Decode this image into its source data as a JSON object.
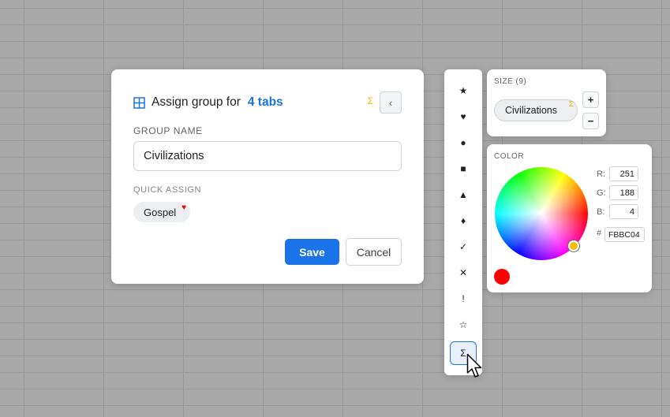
{
  "dialog": {
    "icon": "grid-icon",
    "title": "Assign group for",
    "count": "4 tabs",
    "back_icon": "‹",
    "indicator": "Σ",
    "group_name_label": "GROUP NAME",
    "group_name_value": "Civilizations",
    "quick_assign_label": "QUICK ASSIGN",
    "quick_chip": {
      "label": "Gospel",
      "badge": "♥"
    },
    "save_label": "Save",
    "cancel_label": "Cancel"
  },
  "palette": {
    "symbols": [
      "★",
      "♥",
      "●",
      "■",
      "▲",
      "♦",
      "✓",
      "✕",
      "!",
      "☆",
      "Σ"
    ],
    "selected_index": 10
  },
  "size_panel": {
    "label": "SIZE (9)",
    "chip_label": "Civilizations",
    "chip_badge": "Σ",
    "increase": "+",
    "decrease": "−"
  },
  "color_panel": {
    "label": "COLOR",
    "r_label": "R:",
    "r": "251",
    "g_label": "G:",
    "g": "188",
    "b_label": "B:",
    "b": "4",
    "hash_label": "#",
    "hex": "FBBC04",
    "selected_color": "#FBBC04",
    "swatch_color": "#FF0000"
  }
}
